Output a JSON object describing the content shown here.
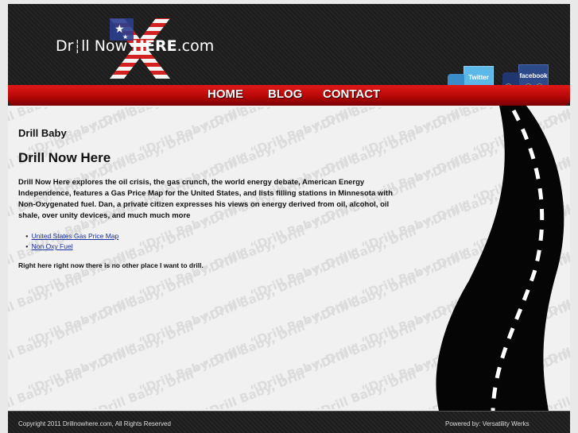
{
  "header": {
    "logo_prefix": "Dr",
    "logo_mid": "ll Now ",
    "logo_here": "HERE",
    "logo_suffix": ".com",
    "nav": {
      "home": "HOME",
      "blog": "BLOG",
      "contact": "CONTACT"
    },
    "twitter": "Twitter",
    "facebook": "facebook"
  },
  "content": {
    "subtitle": "Drill Baby",
    "title": "Drill Now Here",
    "description": "Drill Now Here explores the oil crisis, the gas crunch, the world energy debate, American Energy Independence, features a Gas Price Map for the United States, and lists filling stations in Minnesota with Non-Oxygenated fuel. Dan, a private citizen expresses his views on energy derived from oil, alcohol, oil shale, over unity devices, and much much more",
    "links": [
      "United States Gas Price Map",
      "Non Oxy Fuel"
    ],
    "tagline": "Right here right now there is no other place I want to drill."
  },
  "watermark": "“Drill Baby, Drill”",
  "footer": {
    "copyright": "Copyright 2011 Drillnowhere.com, All Rights Reserved",
    "powered": "Powered by: Versatility Werks"
  },
  "colors": {
    "nav_red": "#c80c0c",
    "twitter_blue": "#5bb8e8",
    "facebook_blue": "#2c4a8a",
    "link": "#1a2fa0"
  }
}
